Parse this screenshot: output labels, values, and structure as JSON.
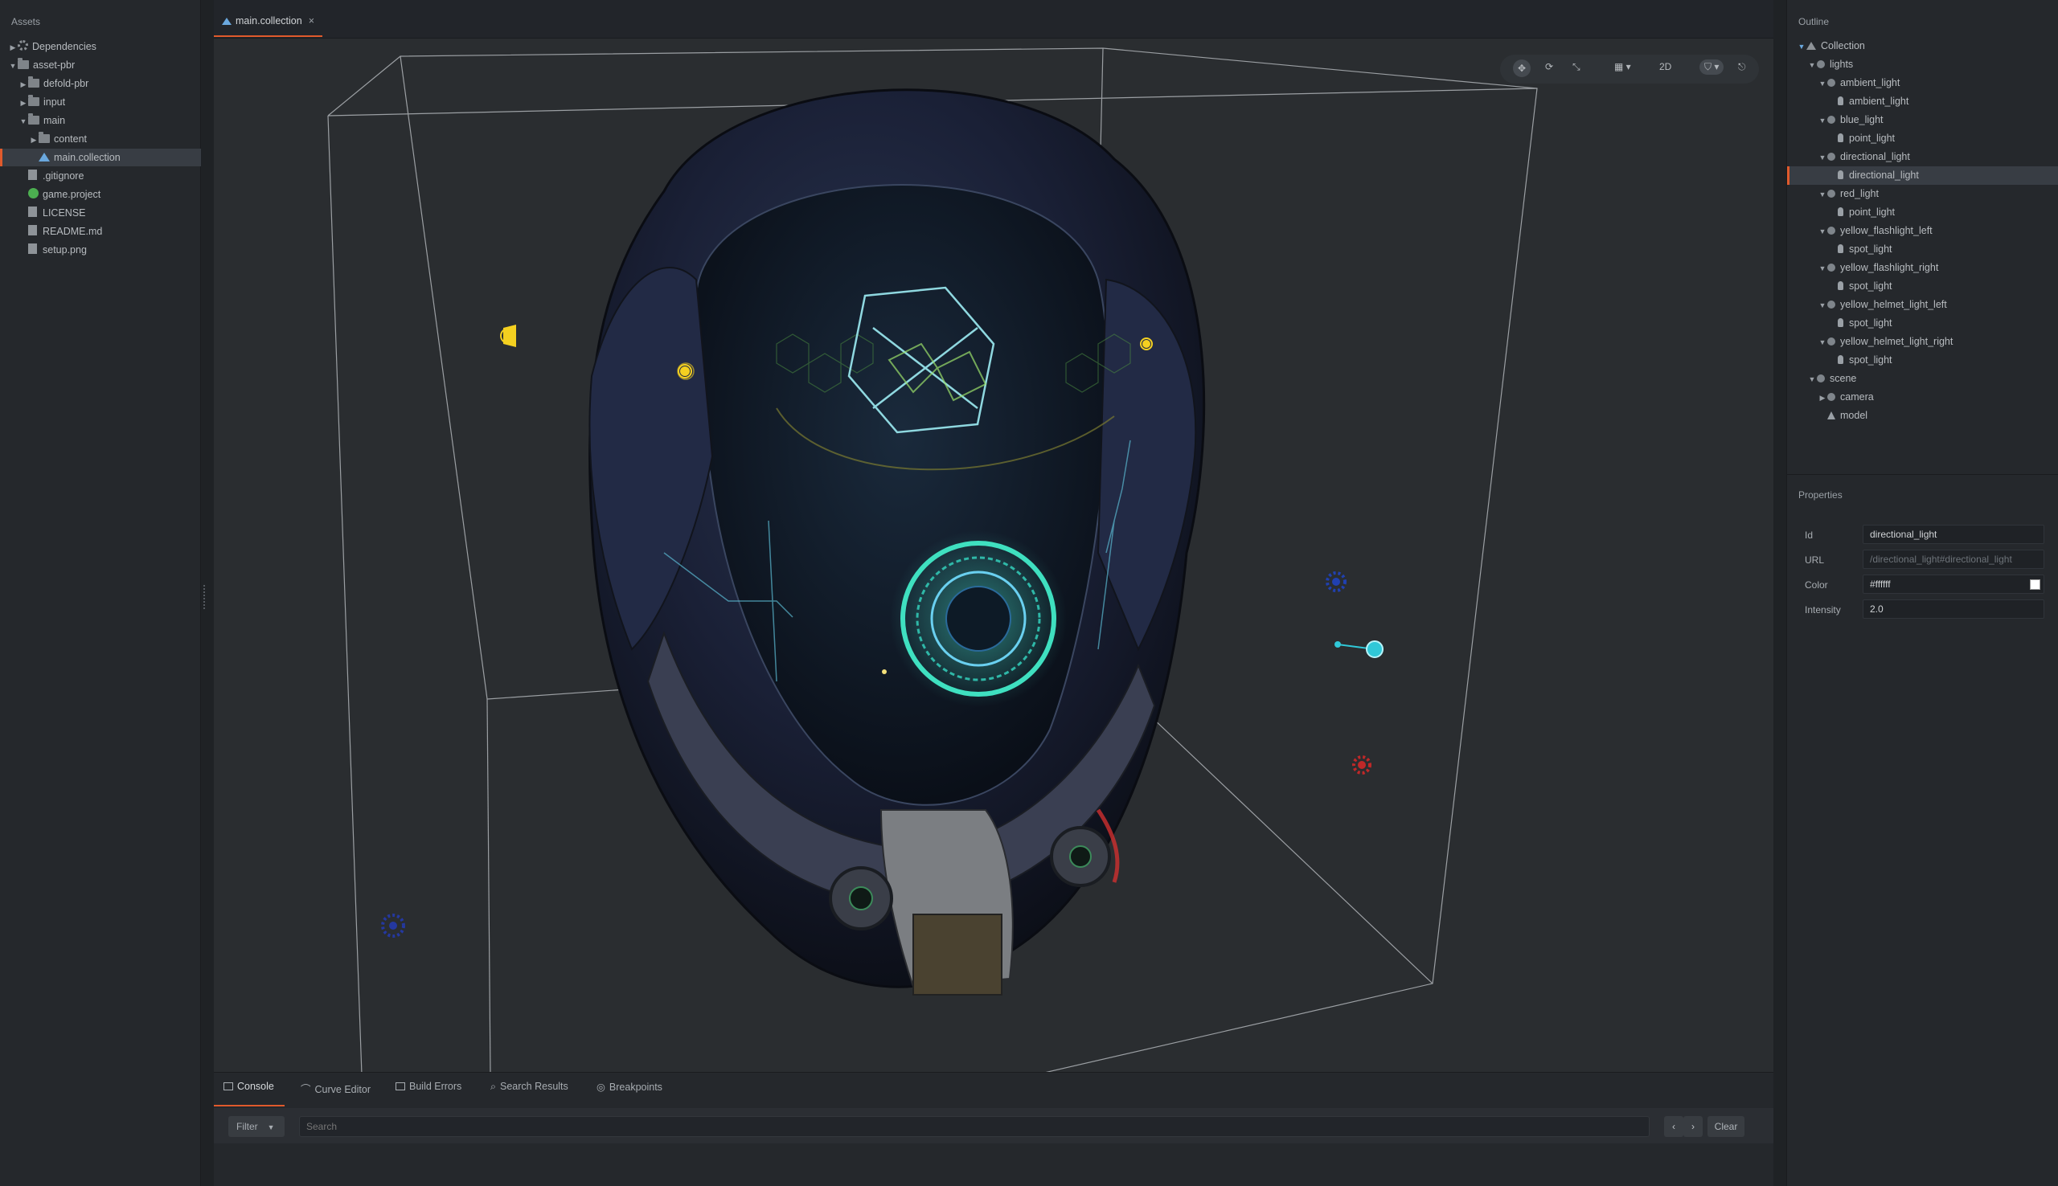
{
  "assets": {
    "title": "Assets",
    "items": [
      {
        "label": "Dependencies",
        "depth": 0,
        "icon": "gear-icon",
        "expanded": false
      },
      {
        "label": "asset-pbr",
        "depth": 0,
        "icon": "folder-icon",
        "expanded": true
      },
      {
        "label": "defold-pbr",
        "depth": 1,
        "icon": "folder-icon",
        "expanded": false
      },
      {
        "label": "input",
        "depth": 1,
        "icon": "folder-icon",
        "expanded": false
      },
      {
        "label": "main",
        "depth": 1,
        "icon": "folder-icon",
        "expanded": true
      },
      {
        "label": "content",
        "depth": 2,
        "icon": "folder-icon",
        "expanded": false
      },
      {
        "label": "main.collection",
        "depth": 2,
        "icon": "collection-icon",
        "selected": true
      },
      {
        "label": ".gitignore",
        "depth": 1,
        "icon": "file-icon"
      },
      {
        "label": "game.project",
        "depth": 1,
        "icon": "project-gear-icon"
      },
      {
        "label": "LICENSE",
        "depth": 1,
        "icon": "file-icon"
      },
      {
        "label": "README.md",
        "depth": 1,
        "icon": "file-icon"
      },
      {
        "label": "setup.png",
        "depth": 1,
        "icon": "image-file-icon"
      }
    ]
  },
  "editor": {
    "tab_label": "main.collection",
    "tab_close": "×",
    "toolbar": {
      "move_icon": "move-tool-icon",
      "rotate_icon": "rotate-tool-icon",
      "scale_icon": "scale-tool-icon",
      "grid_icon": "grid-icon",
      "mode_2d": "2D",
      "visibility_icon": "visibility-filter-icon",
      "camera_icon": "camera-reset-icon"
    }
  },
  "bottom": {
    "tabs": [
      "Console",
      "Curve Editor",
      "Build Errors",
      "Search Results",
      "Breakpoints"
    ],
    "filter_label": "Filter",
    "search_placeholder": "Search",
    "prev": "‹",
    "next": "›",
    "clear_label": "Clear"
  },
  "outline": {
    "title": "Outline",
    "items": [
      {
        "label": "Collection",
        "depth": 0,
        "icon": "collection-icon",
        "expanded": true
      },
      {
        "label": "lights",
        "depth": 1,
        "icon": "game-object-icon",
        "expanded": true
      },
      {
        "label": "ambient_light",
        "depth": 2,
        "icon": "game-object-icon",
        "expanded": true
      },
      {
        "label": "ambient_light",
        "depth": 3,
        "icon": "light-icon"
      },
      {
        "label": "blue_light",
        "depth": 2,
        "icon": "game-object-icon",
        "expanded": true
      },
      {
        "label": "point_light",
        "depth": 3,
        "icon": "light-icon"
      },
      {
        "label": "directional_light",
        "depth": 2,
        "icon": "game-object-icon",
        "expanded": true
      },
      {
        "label": "directional_light",
        "depth": 3,
        "icon": "light-icon",
        "selected": true
      },
      {
        "label": "red_light",
        "depth": 2,
        "icon": "game-object-icon",
        "expanded": true
      },
      {
        "label": "point_light",
        "depth": 3,
        "icon": "light-icon"
      },
      {
        "label": "yellow_flashlight_left",
        "depth": 2,
        "icon": "game-object-icon",
        "expanded": true
      },
      {
        "label": "spot_light",
        "depth": 3,
        "icon": "light-icon"
      },
      {
        "label": "yellow_flashlight_right",
        "depth": 2,
        "icon": "game-object-icon",
        "expanded": true
      },
      {
        "label": "spot_light",
        "depth": 3,
        "icon": "light-icon"
      },
      {
        "label": "yellow_helmet_light_left",
        "depth": 2,
        "icon": "game-object-icon",
        "expanded": true
      },
      {
        "label": "spot_light",
        "depth": 3,
        "icon": "light-icon"
      },
      {
        "label": "yellow_helmet_light_right",
        "depth": 2,
        "icon": "game-object-icon",
        "expanded": true
      },
      {
        "label": "spot_light",
        "depth": 3,
        "icon": "light-icon"
      },
      {
        "label": "scene",
        "depth": 1,
        "icon": "game-object-icon",
        "expanded": true
      },
      {
        "label": "camera",
        "depth": 2,
        "icon": "game-object-icon",
        "expanded": false
      },
      {
        "label": "model",
        "depth": 2,
        "icon": "model-icon"
      }
    ]
  },
  "properties": {
    "title": "Properties",
    "fields": [
      {
        "label": "Id",
        "value": "directional_light"
      },
      {
        "label": "URL",
        "value": "/directional_light#directional_light",
        "readonly": true
      },
      {
        "label": "Color",
        "value": "#ffffff",
        "swatch": "#ffffff"
      },
      {
        "label": "Intensity",
        "value": "2.0"
      }
    ]
  },
  "colors": {
    "accent": "#e05a2c",
    "panel": "#25282c",
    "viewport": "#2a2d30"
  }
}
